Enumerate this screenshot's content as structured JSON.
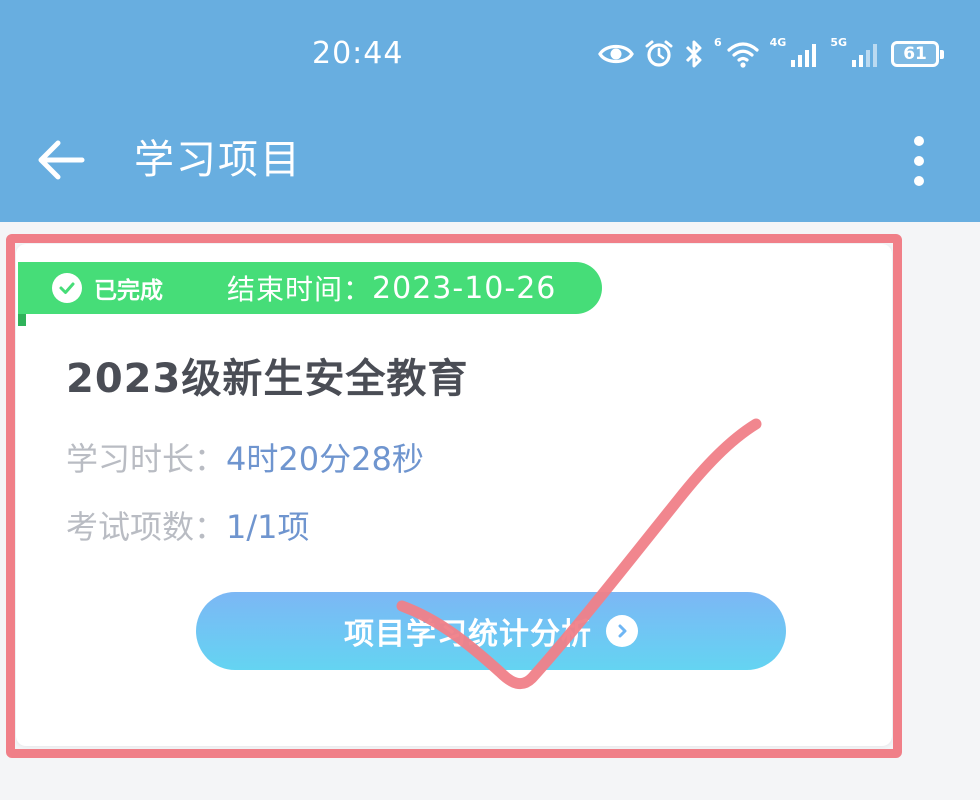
{
  "status_bar": {
    "time": "20:44",
    "wifi_label": "6",
    "net1_label": "4G",
    "net2_label": "5G",
    "battery": "61"
  },
  "header": {
    "title": "学习项目"
  },
  "card": {
    "status_label": "已完成",
    "end_label": "结束时间：",
    "end_date": "2023-10-26",
    "title": "2023级新生安全教育",
    "duration_label": "学习时长：",
    "duration_value": "4时20分28秒",
    "exams_label": "考试项数：",
    "exams_value": "1/1项",
    "button_label": "项目学习统计分析"
  },
  "colors": {
    "header_bg": "#68aee0",
    "status_pill": "#46dd78",
    "button_gradient_top": "#7cb7f5",
    "button_gradient_bottom": "#64d4f2",
    "annotation": "#f07f88"
  },
  "icons": {
    "status_bar": [
      "eye-icon",
      "alarm-icon",
      "bluetooth-icon",
      "wifi-icon",
      "signal-icon",
      "signal-icon",
      "battery-icon"
    ],
    "header": [
      "back-arrow-icon",
      "more-vertical-icon"
    ],
    "card": [
      "check-circle-icon",
      "chevron-right-circle-icon"
    ]
  }
}
